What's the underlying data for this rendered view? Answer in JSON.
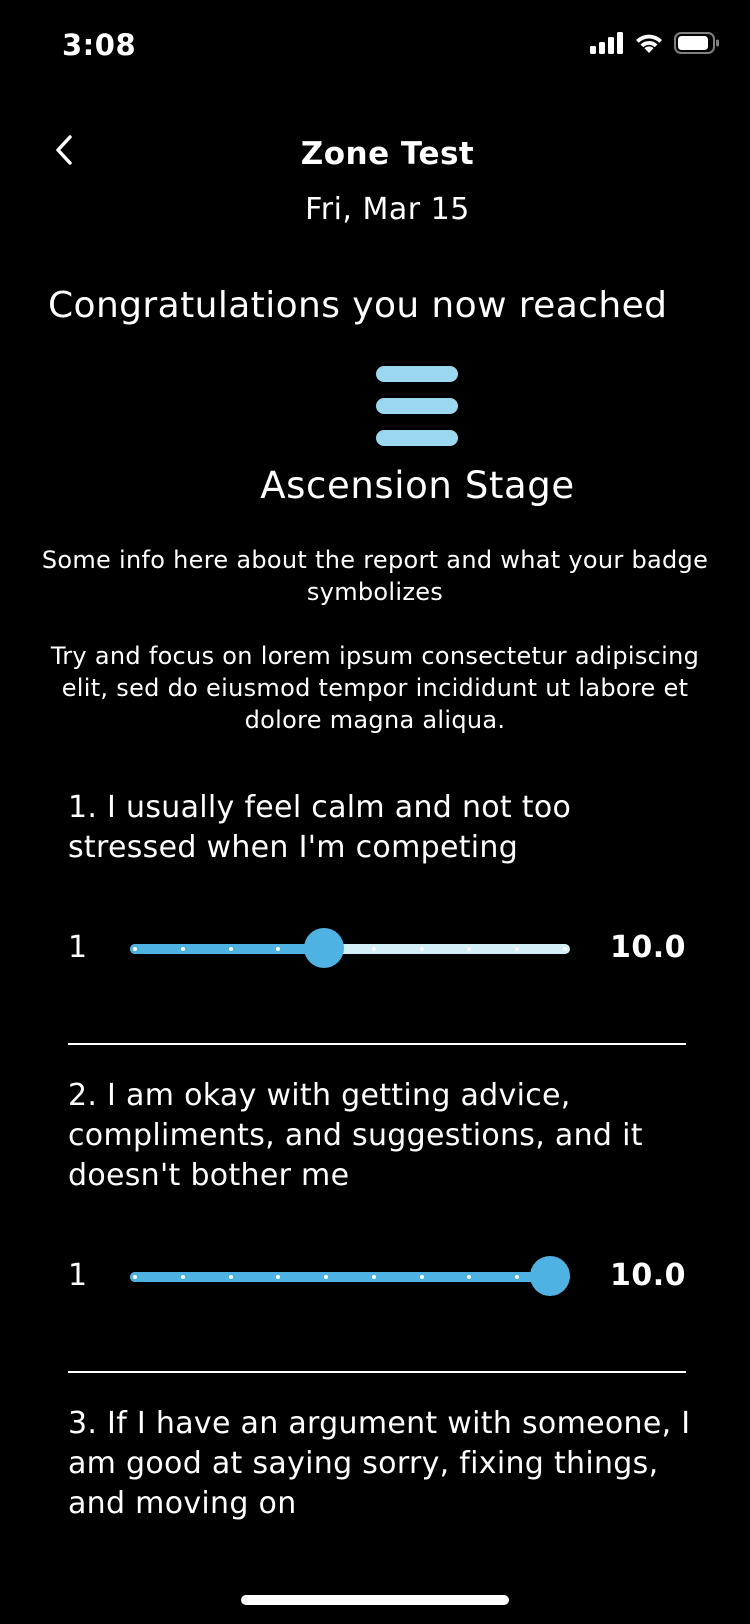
{
  "status_bar": {
    "time": "3:08",
    "icons": [
      "cellular-signal-icon",
      "wifi-icon",
      "battery-icon"
    ]
  },
  "header": {
    "back_icon": "chevron-left-icon",
    "title": "Zone Test",
    "date": "Fri, Mar 15"
  },
  "result": {
    "congrats": "Congratulations you now reached",
    "badge_icon": "three-bars-badge-icon",
    "badge_color": "#9bd8ef",
    "stage": "Ascension Stage",
    "info": "Some info here about the report and what your badge symbolizes",
    "focus": "Try and focus on lorem ipsum consectetur adipiscing elit, sed do eiusmod tempor incididunt ut labore et dolore magna aliqua."
  },
  "questions": [
    {
      "text": "1. I usually feel calm and not too stressed when I'm competing",
      "min_label": "1",
      "max_label": "10.0",
      "value_fraction": 0.44
    },
    {
      "text": "2. I am okay with getting advice, compliments, and suggestions, and it doesn't bother me",
      "min_label": "1",
      "max_label": "10.0",
      "value_fraction": 1.0
    },
    {
      "text": "3. If I have an argument with someone, I am good at saying sorry, fixing things, and moving on"
    }
  ],
  "colors": {
    "background": "#000000",
    "text": "#ffffff",
    "slider_active": "#4eb3e2",
    "slider_inactive": "#d4eff8"
  }
}
